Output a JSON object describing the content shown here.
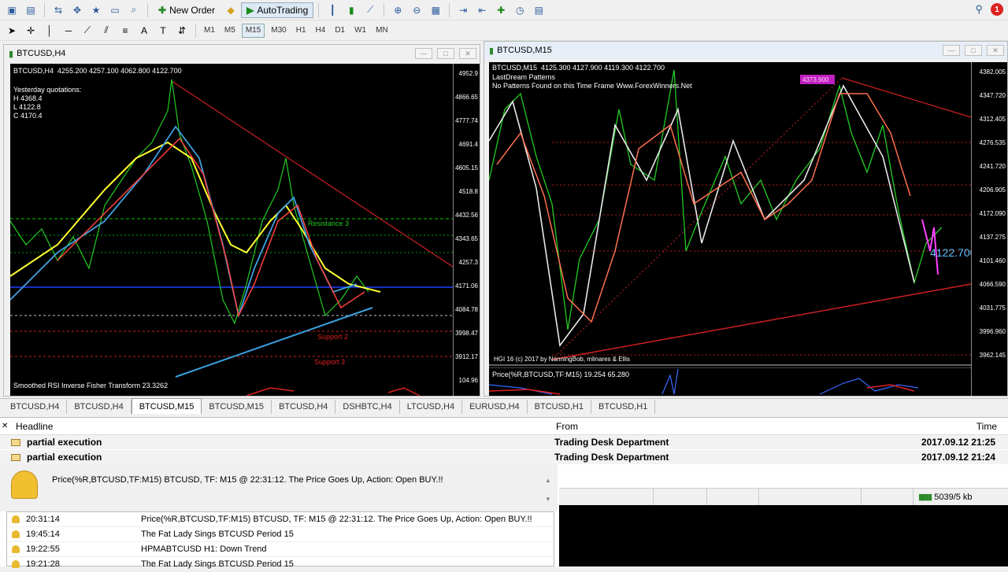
{
  "toolbar": {
    "new_order": "New Order",
    "auto_trading": "AutoTrading",
    "timeframes": [
      "M1",
      "M5",
      "M15",
      "M30",
      "H1",
      "H4",
      "D1",
      "W1",
      "MN"
    ],
    "active_tf": "M15",
    "notification_count": "1"
  },
  "left_chart": {
    "window_title": "BTCUSD,H4",
    "info_line": "BTCUSD,H4  4255.200 4257.100 4062.800 4122.700",
    "quotations": "Yesterday quotations:\nH 4368.4\nL 4122.8\nC 4170.4",
    "label_resistance": "Resistance 3",
    "label_support2": "Support 2",
    "label_support3": "Support 3",
    "indicator": "Smoothed RSI Inverse Fisher Transform 23.3262",
    "price_axis": [
      "4952.9",
      "4866.65",
      "4777.74",
      "4691.4",
      "4605.15",
      "4518.8",
      "4432.56",
      "4343.65",
      "4257.3",
      "4171.06",
      "4084.78",
      "3998.47",
      "3912.17",
      "104.96"
    ]
  },
  "right_chart": {
    "window_title": "BTCUSD,M15",
    "info_line": "BTCUSD,M15  4125.300 4127.900 4119.300 4122.700",
    "patterns_line1": "LastDream Patterns",
    "patterns_line2": "No Patterns Found on this Time Frame Www.ForexWinners.Net",
    "price_bubble": "4122.700",
    "top_tag": "4373.900",
    "bottom_credit": "HGI 16 (c) 2017 by NanningBob, mlinares & Ellis",
    "subwindow": "Price(%R,BTCUSD,TF:M15) 19.254 65.280",
    "price_axis": [
      "4382.005",
      "4347.720",
      "4312.405",
      "4276.535",
      "4241.720",
      "4206.905",
      "4172.090",
      "4137.275",
      "4101.460",
      "4066.590",
      "4031.775",
      "3996.960",
      "3962.145"
    ],
    "current_price": "4122.700"
  },
  "tabs": [
    "BTCUSD,H4",
    "BTCUSD,H4",
    "BTCUSD,M15",
    "BTCUSD,M15",
    "BTCUSD,H4",
    "DSHBTC,H4",
    "LTCUSD,H4",
    "EURUSD,H4",
    "BTCUSD,H1",
    "BTCUSD,H1"
  ],
  "active_tab": 2,
  "news": {
    "col_headline": "Headline",
    "col_from": "From",
    "col_time": "Time",
    "rows": [
      {
        "headline": "partial execution",
        "from": "Trading Desk Department",
        "time": "2017.09.12 21:25"
      },
      {
        "headline": "partial execution",
        "from": "Trading Desk Department",
        "time": "2017.09.12 21:24"
      }
    ]
  },
  "alert": {
    "message": "Price(%R,BTCUSD,TF:M15) BTCUSD, TF: M15 @ 22:31:12. The Price Goes Up, Action: Open BUY.!!",
    "list": [
      {
        "time": "20:31:14",
        "text": "Price(%R,BTCUSD,TF:M15) BTCUSD, TF: M15 @ 22:31:12. The Price Goes Up, Action: Open BUY.!!"
      },
      {
        "time": "19:45:14",
        "text": "The Fat Lady Sings BTCUSD Period 15"
      },
      {
        "time": "19:22:55",
        "text": "HPMABTCUSD H1: Down Trend"
      },
      {
        "time": "19:21:28",
        "text": "The Fat Lady Sings BTCUSD Period 15"
      }
    ]
  },
  "status": {
    "traffic": "5039/5 kb"
  }
}
